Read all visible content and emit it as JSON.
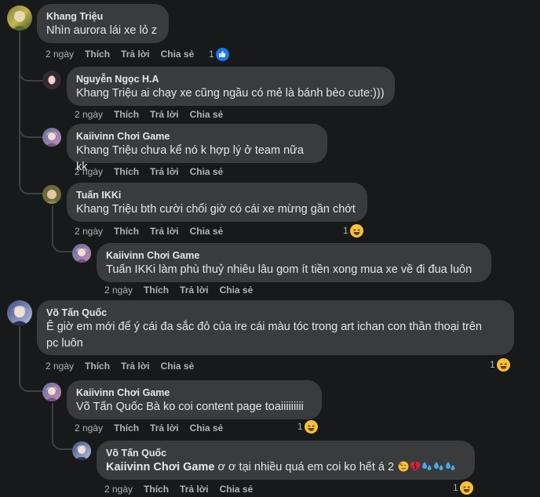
{
  "comments": [
    {
      "author": "Khang Triệu",
      "text": "Nhìn aurora lái xe lỏ z",
      "time": "2 ngày",
      "like": "Thích",
      "reply": "Trả lời",
      "share": "Chia sẻ",
      "reaction_count": "1",
      "reaction": "like"
    },
    {
      "author": "Nguyễn Ngọc H.A",
      "text": "Khang Triệu ai chạy xe cũng ngầu có mẻ là bánh bèo cute:)))",
      "time": "2 ngày",
      "like": "Thích",
      "reply": "Trả lời",
      "share": "Chia sẻ"
    },
    {
      "author": "Kaiivinn Chơi Game",
      "text": "Khang Triệu chưa kể nó k hợp lý ở team nữa kk",
      "time": "2 ngày",
      "like": "Thích",
      "reply": "Trả lời",
      "share": "Chia sẻ"
    },
    {
      "author": "Tuấn IKKi",
      "text": "Khang Triệu bth cười chổi giờ có cái xe mừng gần chớt",
      "time": "2 ngày",
      "like": "Thích",
      "reply": "Trả lời",
      "share": "Chia sẻ",
      "reaction_count": "1",
      "reaction": "haha"
    },
    {
      "author": "Kaiivinn Chơi Game",
      "text": "Tuấn IKKi làm phù thuỷ nhiêu lâu gom ít tiền xong mua xe về đi đua luôn",
      "time": "2 ngày",
      "like": "Thích",
      "reply": "Trả lời",
      "share": "Chia sẻ"
    },
    {
      "author": "Võ Tấn Quốc",
      "text_line1": "Ê giờ em mới để ý cái đa sắc đỏ của ire cái màu tóc trong art ichan con thần thoại trên",
      "text_line2": "pc luôn",
      "time": "2 ngày",
      "like": "Thích",
      "reply": "Trả lời",
      "share": "Chia sẻ",
      "reaction_count": "1",
      "reaction": "haha"
    },
    {
      "author": "Kaiivinn Chơi Game",
      "text": "Võ Tấn Quốc Bà ko coi content page toaiiiiiiiii",
      "time": "2 ngày",
      "like": "Thích",
      "reply": "Trả lời",
      "share": "Chia sẻ",
      "reaction_count": "1",
      "reaction": "haha"
    },
    {
      "author": "Võ Tấn Quốc",
      "mention": "Kaiivinn Chơi Game",
      "text": " ơ ơ tại nhiều quá em coi ko hết á 2 ",
      "emojis": [
        "smiling-face-with-hearts",
        "broken-heart",
        "sweat-droplets",
        "sweat-droplets",
        "sweat-droplets"
      ],
      "time": "2 ngày",
      "like": "Thích",
      "reply": "Trả lời",
      "share": "Chia sẻ",
      "reaction_count": "1",
      "reaction": "haha"
    }
  ],
  "colors": {
    "background": "#18191a",
    "bubble": "#3a3b3c",
    "text": "#e4e6eb",
    "secondary": "#b0b3b8",
    "like_blue": "#1877f2",
    "haha_yellow": "#f7c23b"
  }
}
